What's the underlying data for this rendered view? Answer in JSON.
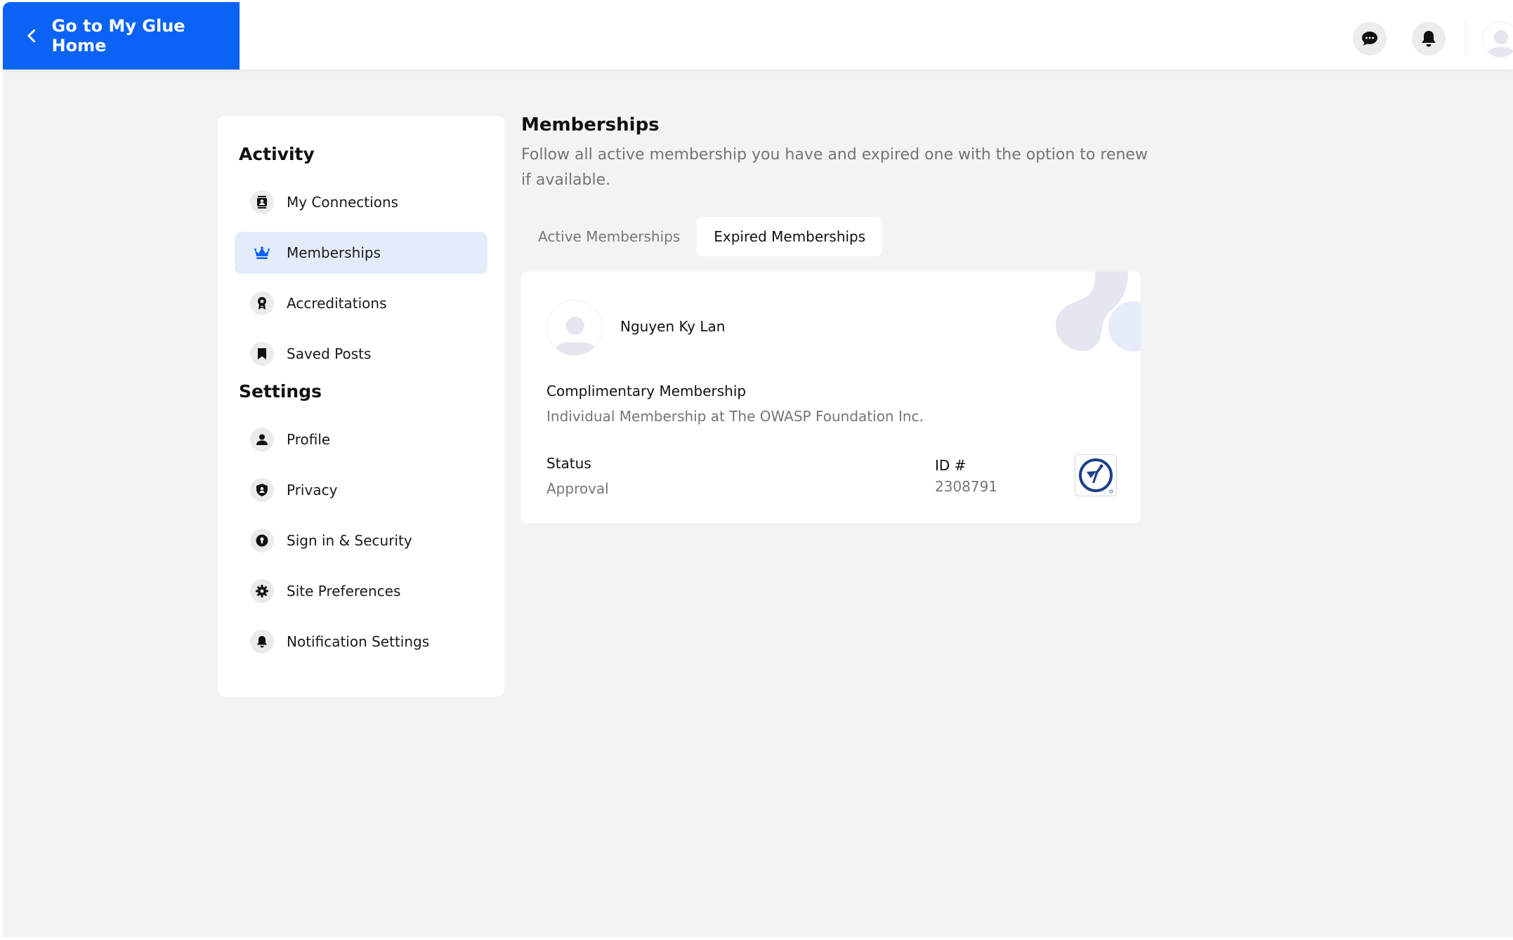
{
  "header": {
    "home_button_label": "Go to My Glue Home",
    "icons": [
      "chat-icon",
      "bell-icon",
      "user-avatar"
    ]
  },
  "sidebar": {
    "sections": [
      {
        "heading": "Activity",
        "items": [
          {
            "label": "My Connections",
            "icon": "contacts-icon",
            "active": false
          },
          {
            "label": "Memberships",
            "icon": "crown-icon",
            "active": true
          },
          {
            "label": "Accreditations",
            "icon": "award-icon",
            "active": false
          },
          {
            "label": "Saved Posts",
            "icon": "bookmark-icon",
            "active": false
          }
        ]
      },
      {
        "heading": "Settings",
        "items": [
          {
            "label": "Profile",
            "icon": "person-icon",
            "active": false
          },
          {
            "label": "Privacy",
            "icon": "shield-icon",
            "active": false
          },
          {
            "label": "Sign in & Security",
            "icon": "lock-icon",
            "active": false
          },
          {
            "label": "Site Preferences",
            "icon": "gear-icon",
            "active": false
          },
          {
            "label": "Notification Settings",
            "icon": "bell-icon",
            "active": false
          }
        ]
      }
    ]
  },
  "main": {
    "title": "Memberships",
    "description": "Follow all active membership you have and expired one with the option to renew if available.",
    "tabs": [
      {
        "label": "Active Memberships",
        "active": false
      },
      {
        "label": "Expired Memberships",
        "active": true
      }
    ],
    "membership_card": {
      "member_name": "Nguyen Ky Lan",
      "plan_name": "Complimentary Membership",
      "plan_org": "Individual Membership at The OWASP Foundation Inc.",
      "status_label": "Status",
      "status_value": "Approval",
      "id_label": "ID #",
      "id_value": "2308791",
      "org_logo": "owasp-logo"
    }
  },
  "colors": {
    "accent": "#0b63f6",
    "active_item_bg": "#e4ecfb",
    "page_bg": "#f3f3f3",
    "owasp_blue": "#1f3f8a"
  }
}
